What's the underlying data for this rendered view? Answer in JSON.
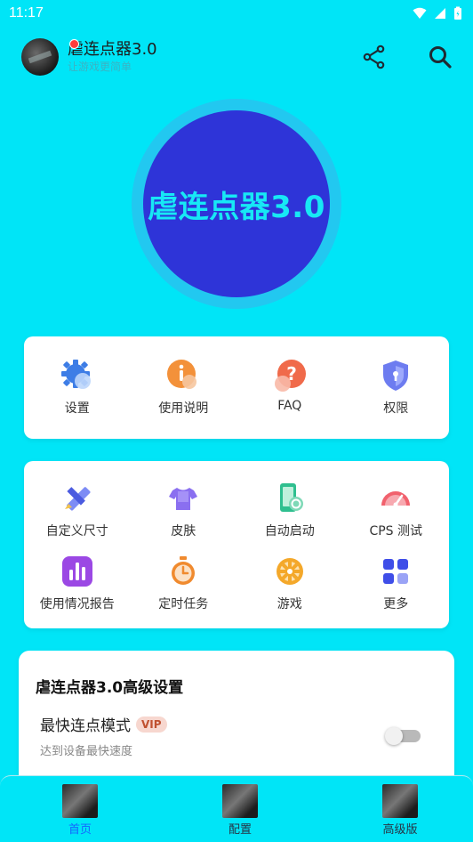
{
  "status_bar": {
    "time": "11:17"
  },
  "header": {
    "title": "虐连点器3.0",
    "subtitle": "让游戏更简单"
  },
  "main_button": {
    "label": "虐连点器3.0"
  },
  "quick_menu": {
    "items": [
      {
        "label": "设置",
        "icon": "gear-icon"
      },
      {
        "label": "使用说明",
        "icon": "info-icon"
      },
      {
        "label": "FAQ",
        "icon": "question-icon"
      },
      {
        "label": "权限",
        "icon": "shield-lock-icon"
      }
    ]
  },
  "tools_menu": {
    "items": [
      {
        "label": "自定义尺寸",
        "icon": "ruler-pencil-icon"
      },
      {
        "label": "皮肤",
        "icon": "tshirt-icon"
      },
      {
        "label": "自动启动",
        "icon": "phone-link-icon"
      },
      {
        "label": "CPS 测试",
        "icon": "speedometer-icon"
      },
      {
        "label": "使用情况报告",
        "icon": "bar-chart-icon"
      },
      {
        "label": "定时任务",
        "icon": "stopwatch-icon"
      },
      {
        "label": "游戏",
        "icon": "wheel-icon"
      },
      {
        "label": "更多",
        "icon": "grid-icon"
      }
    ]
  },
  "advanced": {
    "title": "虐连点器3.0高级设置",
    "fastest_mode": {
      "label": "最快连点模式",
      "badge": "VIP",
      "description": "达到设备最快速度",
      "enabled": false
    }
  },
  "bottom_nav": {
    "items": [
      {
        "label": "首页",
        "active": true
      },
      {
        "label": "配置",
        "active": false
      },
      {
        "label": "高级版",
        "active": false
      }
    ]
  },
  "colors": {
    "background": "#00e5f7",
    "circle": "#2e34d8",
    "circle_ring": "#22c8f0",
    "circle_text": "#17e8f5",
    "nav_active": "#1565ff",
    "vip_badge_bg": "#f7d7cf"
  }
}
